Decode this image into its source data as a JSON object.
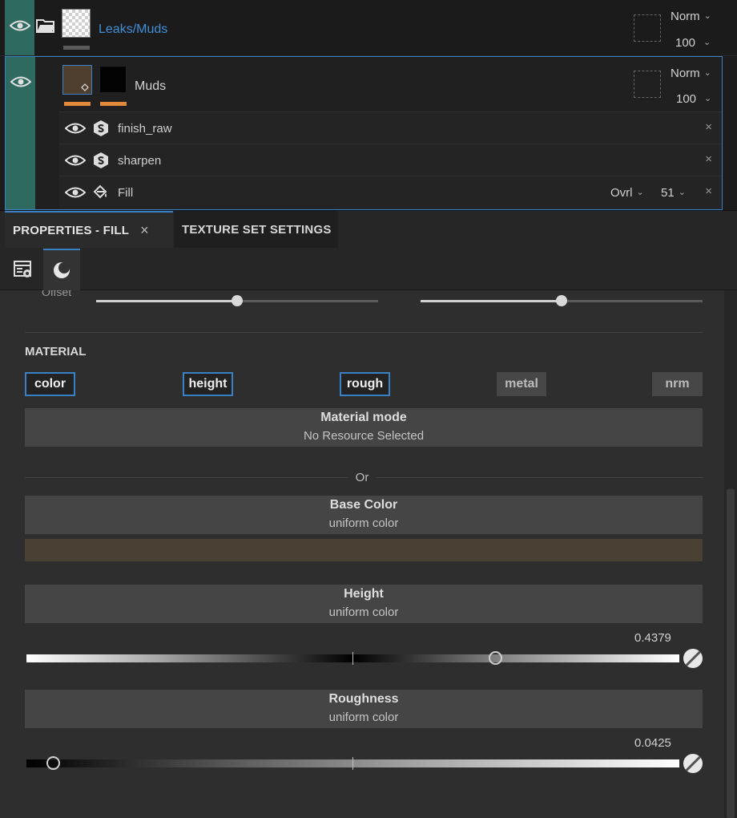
{
  "layers": {
    "group": {
      "name": "Leaks/Muds",
      "blend_mode": "Norm",
      "opacity": "100"
    },
    "layer": {
      "name": "Muds",
      "blend_mode": "Norm",
      "opacity": "100"
    },
    "effects": [
      {
        "name": "finish_raw",
        "icon": "substance-icon",
        "close": "×"
      },
      {
        "name": "sharpen",
        "icon": "substance-icon",
        "close": "×"
      },
      {
        "name": "Fill",
        "icon": "paint-bucket-icon",
        "blend_mode": "Ovrl",
        "opacity": "51",
        "close": "×"
      }
    ]
  },
  "tabs": {
    "properties": "PROPERTIES - FILL",
    "properties_close": "×",
    "texture_set": "TEXTURE SET SETTINGS"
  },
  "properties": {
    "offset_label": "Offset",
    "material_title": "MATERIAL",
    "channels": [
      {
        "label": "color",
        "active": true
      },
      {
        "label": "height",
        "active": true
      },
      {
        "label": "rough",
        "active": true
      },
      {
        "label": "metal",
        "active": false
      },
      {
        "label": "nrm",
        "active": false
      }
    ],
    "material_mode": {
      "title": "Material mode",
      "value": "No Resource Selected"
    },
    "or_text": "Or",
    "base_color": {
      "title": "Base Color",
      "value": "uniform color",
      "swatch": "#4b4034"
    },
    "height": {
      "title": "Height",
      "value": "uniform color",
      "number": "0.4379"
    },
    "roughness": {
      "title": "Roughness",
      "value": "uniform color",
      "number": "0.0425"
    }
  },
  "colors": {
    "accent": "#3a80c4",
    "group_name": "#3f8fd6",
    "layer_strip": "#2f6a60",
    "mask_bar": "#e08a3a"
  }
}
